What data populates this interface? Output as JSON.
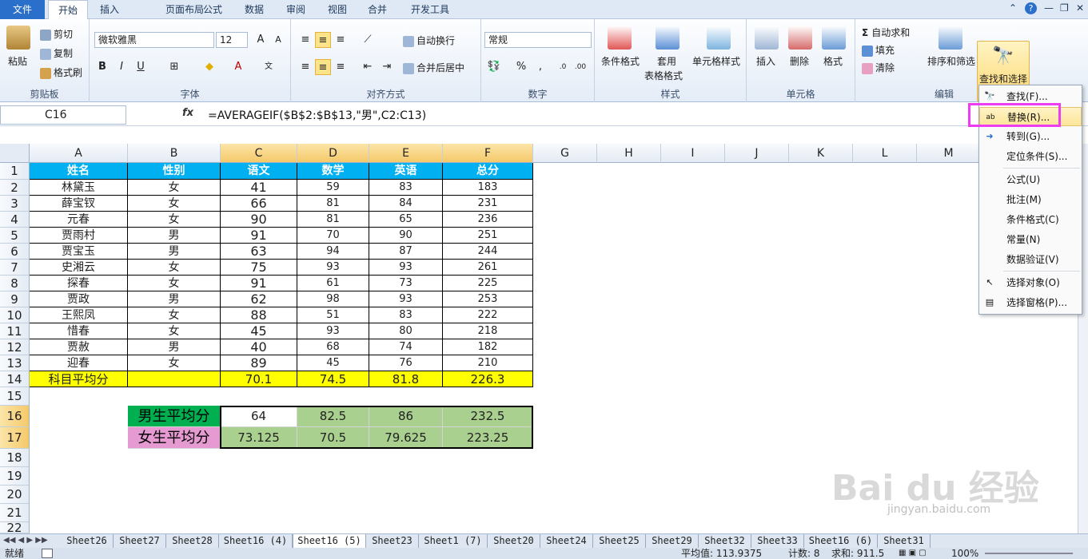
{
  "menubar": {
    "tabs": [
      "文件",
      "开始",
      "插入",
      "页面布局",
      "公式",
      "数据",
      "审阅",
      "视图",
      "合并",
      "开发工具"
    ]
  },
  "ribbon": {
    "clipboard": {
      "paste": "粘贴",
      "cut": "剪切",
      "copy": "复制",
      "format_painter": "格式刷",
      "label": "剪贴板"
    },
    "font": {
      "name": "微软雅黑",
      "size": "12",
      "label": "字体",
      "bold": "B",
      "italic": "I",
      "underline": "U"
    },
    "align": {
      "wrap": "自动换行",
      "merge": "合并后居中",
      "label": "对齐方式"
    },
    "number": {
      "format": "常规",
      "percent": "%",
      "comma": ",",
      "label": "数字"
    },
    "styles": {
      "conditional": "条件格式",
      "table1": "套用",
      "table2": "表格格式",
      "cell_styles": "单元格样式",
      "label": "样式"
    },
    "cells": {
      "insert": "插入",
      "delete": "删除",
      "format": "格式",
      "label": "单元格"
    },
    "editing": {
      "autosum": "自动求和",
      "fill": "填充",
      "clear": "清除",
      "sort": "排序和筛选",
      "find": "查找和选择",
      "label": "编辑"
    }
  },
  "formula_bar": {
    "name_box": "C16",
    "fx": "fx",
    "formula": "=AVERAGEIF($B$2:$B$13,\"男\",C2:C13)"
  },
  "columns": [
    "A",
    "B",
    "C",
    "D",
    "E",
    "F",
    "G",
    "H",
    "I",
    "J",
    "K",
    "L",
    "M"
  ],
  "rows": [
    "1",
    "2",
    "3",
    "4",
    "5",
    "6",
    "7",
    "8",
    "9",
    "10",
    "11",
    "12",
    "13",
    "14",
    "15",
    "16",
    "17",
    "18",
    "19",
    "20",
    "21",
    "22"
  ],
  "table": {
    "header": [
      "姓名",
      "性别",
      "语文",
      "数学",
      "英语",
      "总分"
    ],
    "data": [
      [
        "林黛玉",
        "女",
        "41",
        "59",
        "83",
        "183"
      ],
      [
        "薛宝钗",
        "女",
        "66",
        "81",
        "84",
        "231"
      ],
      [
        "元春",
        "女",
        "90",
        "81",
        "65",
        "236"
      ],
      [
        "贾雨村",
        "男",
        "91",
        "70",
        "90",
        "251"
      ],
      [
        "贾宝玉",
        "男",
        "63",
        "94",
        "87",
        "244"
      ],
      [
        "史湘云",
        "女",
        "75",
        "93",
        "93",
        "261"
      ],
      [
        "探春",
        "女",
        "91",
        "61",
        "73",
        "225"
      ],
      [
        "贾政",
        "男",
        "62",
        "98",
        "93",
        "253"
      ],
      [
        "王熙凤",
        "女",
        "88",
        "51",
        "83",
        "222"
      ],
      [
        "惜春",
        "女",
        "45",
        "93",
        "80",
        "218"
      ],
      [
        "贾赦",
        "男",
        "40",
        "68",
        "74",
        "182"
      ],
      [
        "迎春",
        "女",
        "89",
        "45",
        "76",
        "210"
      ]
    ],
    "avg": [
      "科目平均分",
      "",
      "70.1",
      "74.5",
      "81.8",
      "226.3"
    ]
  },
  "summary": {
    "male": [
      "男生平均分",
      "64",
      "82.5",
      "86",
      "232.5"
    ],
    "female": [
      "女生平均分",
      "73.125",
      "70.5",
      "79.625",
      "223.25"
    ]
  },
  "dropdown": {
    "items": [
      "查找(F)...",
      "替换(R)...",
      "转到(G)...",
      "定位条件(S)...",
      "公式(U)",
      "批注(M)",
      "条件格式(C)",
      "常量(N)",
      "数据验证(V)",
      "选择对象(O)",
      "选择窗格(P)..."
    ]
  },
  "sheets": [
    "Sheet26",
    "Sheet27",
    "Sheet28",
    "Sheet16 (4)",
    "Sheet16 (5)",
    "Sheet23",
    "Sheet1 (7)",
    "Sheet20",
    "Sheet24",
    "Sheet25",
    "Sheet29",
    "Sheet32",
    "Sheet33",
    "Sheet16 (6)",
    "Sheet31"
  ],
  "status": {
    "ready": "就绪",
    "average": "平均值: 113.9375",
    "count": "计数: 8",
    "sum": "求和: 911.5",
    "zoom": "100%"
  },
  "watermark": {
    "main": "Bai du 经验",
    "sub": "jingyan.baidu.com"
  },
  "colors": {
    "header_blue": "#00b0f0",
    "avg_yellow": "#ffff00",
    "green": "#a9d08e",
    "male_green": "#00b050",
    "female_pink": "#e69ad2",
    "highlight": "#ee3cf0"
  }
}
